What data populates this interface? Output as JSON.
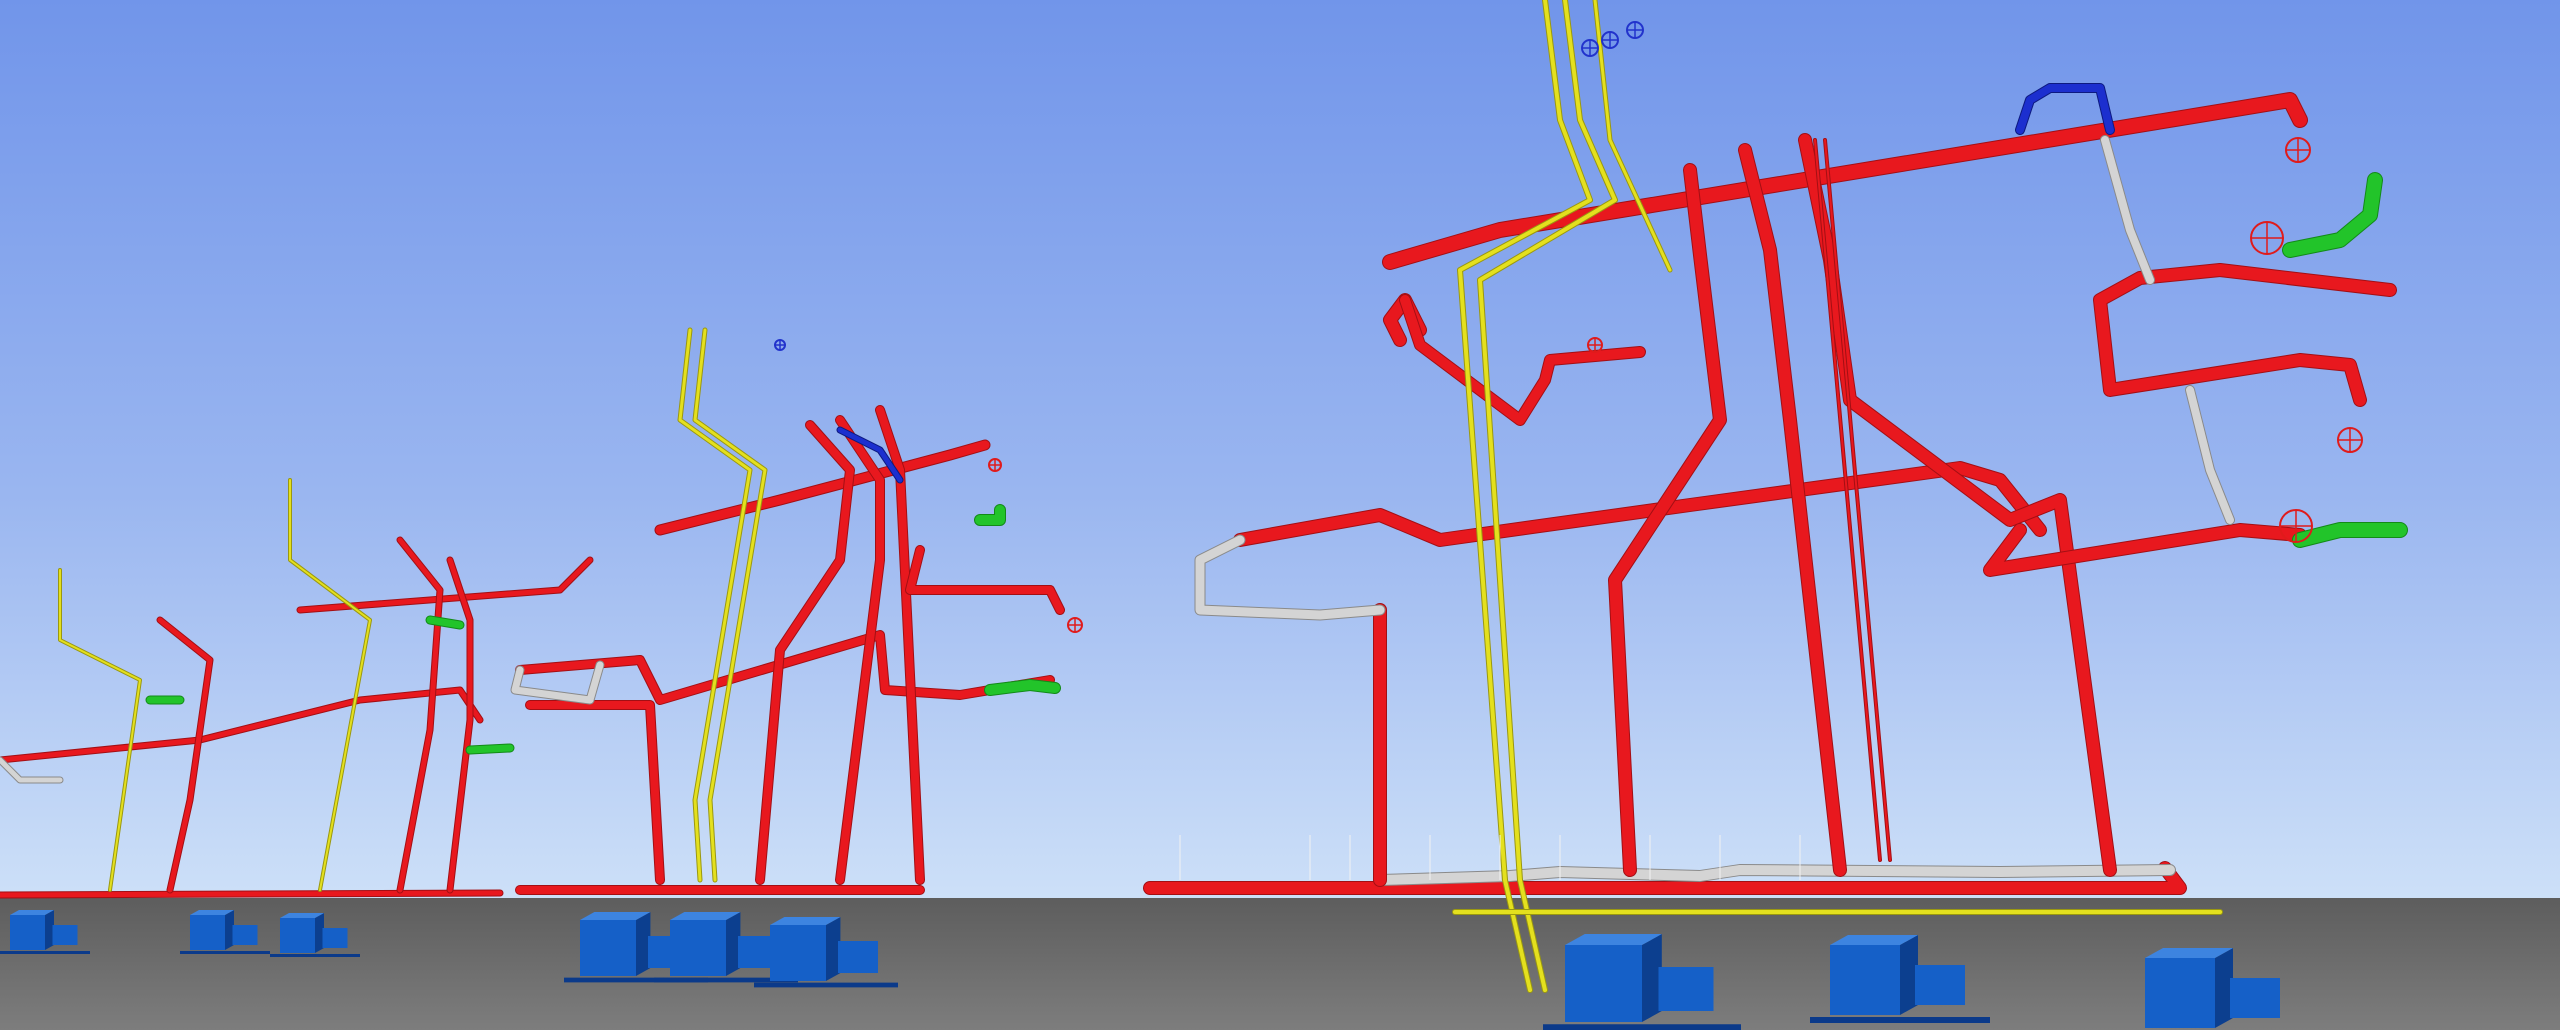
{
  "scene": {
    "colors": {
      "sky_top": "#7195ea",
      "sky_mid": "#9ab6f0",
      "sky_bottom": "#cde0f8",
      "floor_top": "#5d5d5d",
      "floor_bottom": "#7d7d7d",
      "red_pipe": "#e8181e",
      "red_pipe_dark": "#a30f14",
      "yellow_pipe": "#e4e01e",
      "green_pipe": "#22c42a",
      "blue_pipe": "#1c2fcf",
      "grey_pipe": "#d4d4d4",
      "pump_blue": "#1560c8",
      "pump_blue_dark": "#0c3f8f",
      "valve_red": "#e01b1b",
      "valve_blue": "#2233cc"
    },
    "icons": [
      "handwheel-valve-icon",
      "pump-icon",
      "pipe-support-icon"
    ]
  }
}
